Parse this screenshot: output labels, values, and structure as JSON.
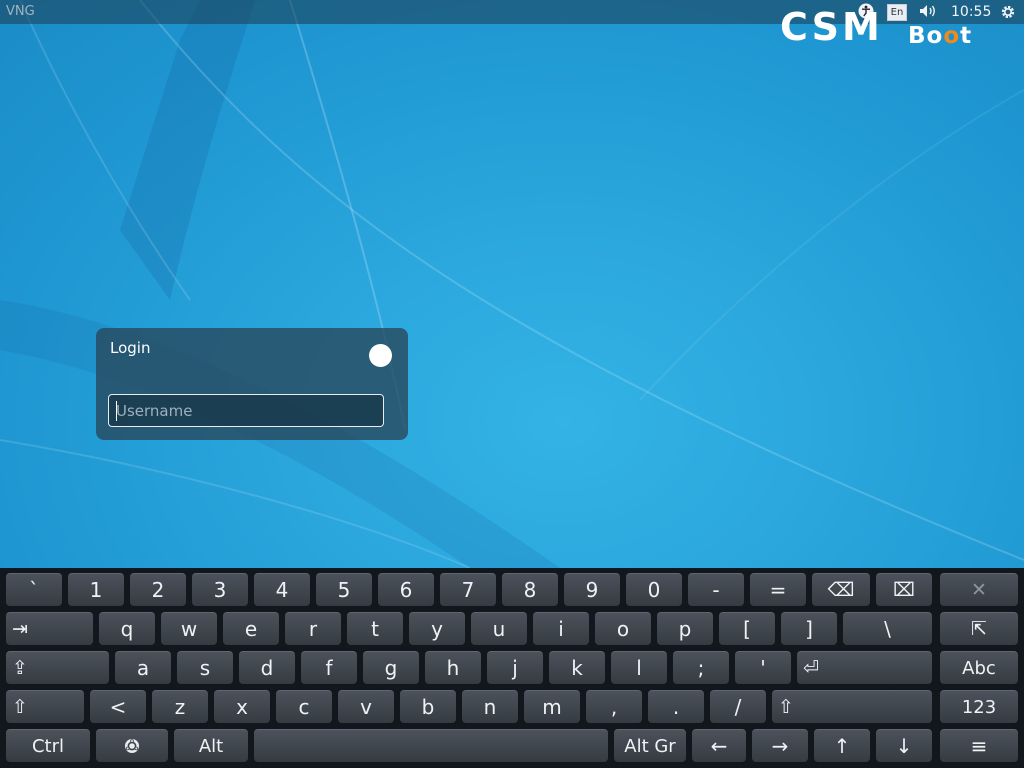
{
  "panel": {
    "hostname": "VNG",
    "keyboard_layout": "En",
    "time": "10:55",
    "icons": [
      "accessibility-icon",
      "keyboard-layout-indicator",
      "volume-icon",
      "power-gear-icon"
    ]
  },
  "logo": {
    "primary": "CSM",
    "secondary_pre": "B",
    "secondary_o1": "o",
    "secondary_o2": "o",
    "secondary_post": "t"
  },
  "login": {
    "title": "Login",
    "username_placeholder": "Username"
  },
  "keyboard": {
    "row1": [
      "`",
      "1",
      "2",
      "3",
      "4",
      "5",
      "6",
      "7",
      "8",
      "9",
      "0",
      "-",
      "="
    ],
    "row2": [
      "q",
      "w",
      "e",
      "r",
      "t",
      "y",
      "u",
      "i",
      "o",
      "p",
      "[",
      "]",
      "\\"
    ],
    "row3": [
      "a",
      "s",
      "d",
      "f",
      "g",
      "h",
      "j",
      "k",
      "l",
      ";",
      "'"
    ],
    "row4": [
      "<",
      "z",
      "x",
      "c",
      "v",
      "b",
      "n",
      "m",
      ",",
      ".",
      "/"
    ],
    "tab": "⇥",
    "backspace": "⌫",
    "clear": "⌧",
    "close": "✕",
    "pointer": "⇱",
    "capslock": "⇪",
    "enter": "⏎",
    "shift_left": "⇧",
    "shift_right": "⇧",
    "abc": "Abc",
    "num": "123",
    "ctrl": "Ctrl",
    "super": "⚙",
    "alt": "Alt",
    "space": "",
    "altgr": "Alt Gr",
    "left": "←",
    "right": "→",
    "up": "↑",
    "down": "↓",
    "menu": "≡"
  }
}
